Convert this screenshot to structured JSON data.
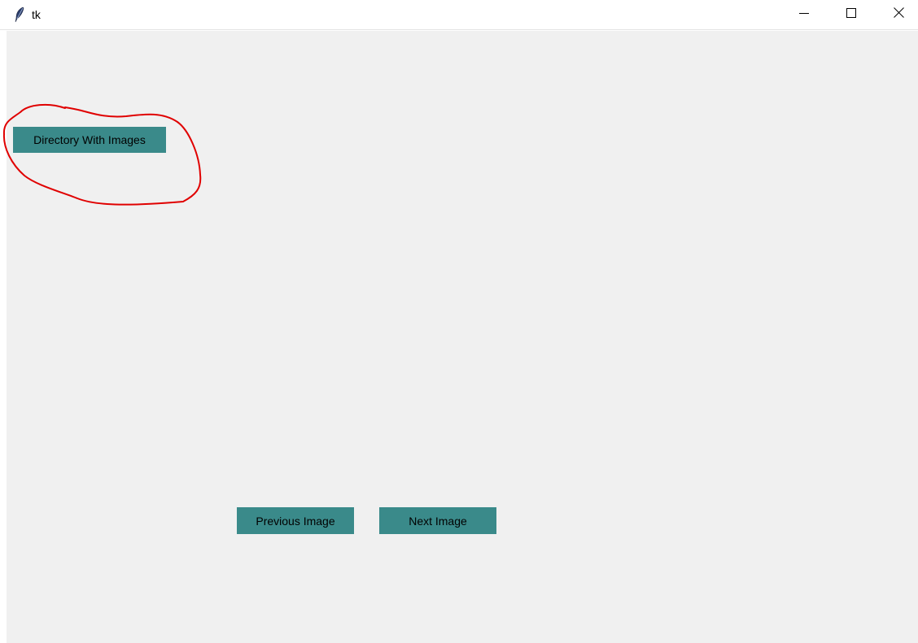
{
  "window": {
    "title": "tk",
    "icon": "tk-feather-icon",
    "controls": [
      "minimize-icon",
      "maximize-icon",
      "close-icon"
    ]
  },
  "main": {
    "directory_button_label": "Directory With Images",
    "previous_button_label": "Previous Image",
    "next_button_label": "Next Image"
  },
  "colors": {
    "button_bg": "#3a8a8a",
    "content_bg": "#f0f0f0",
    "annotation_stroke": "#e00000"
  }
}
